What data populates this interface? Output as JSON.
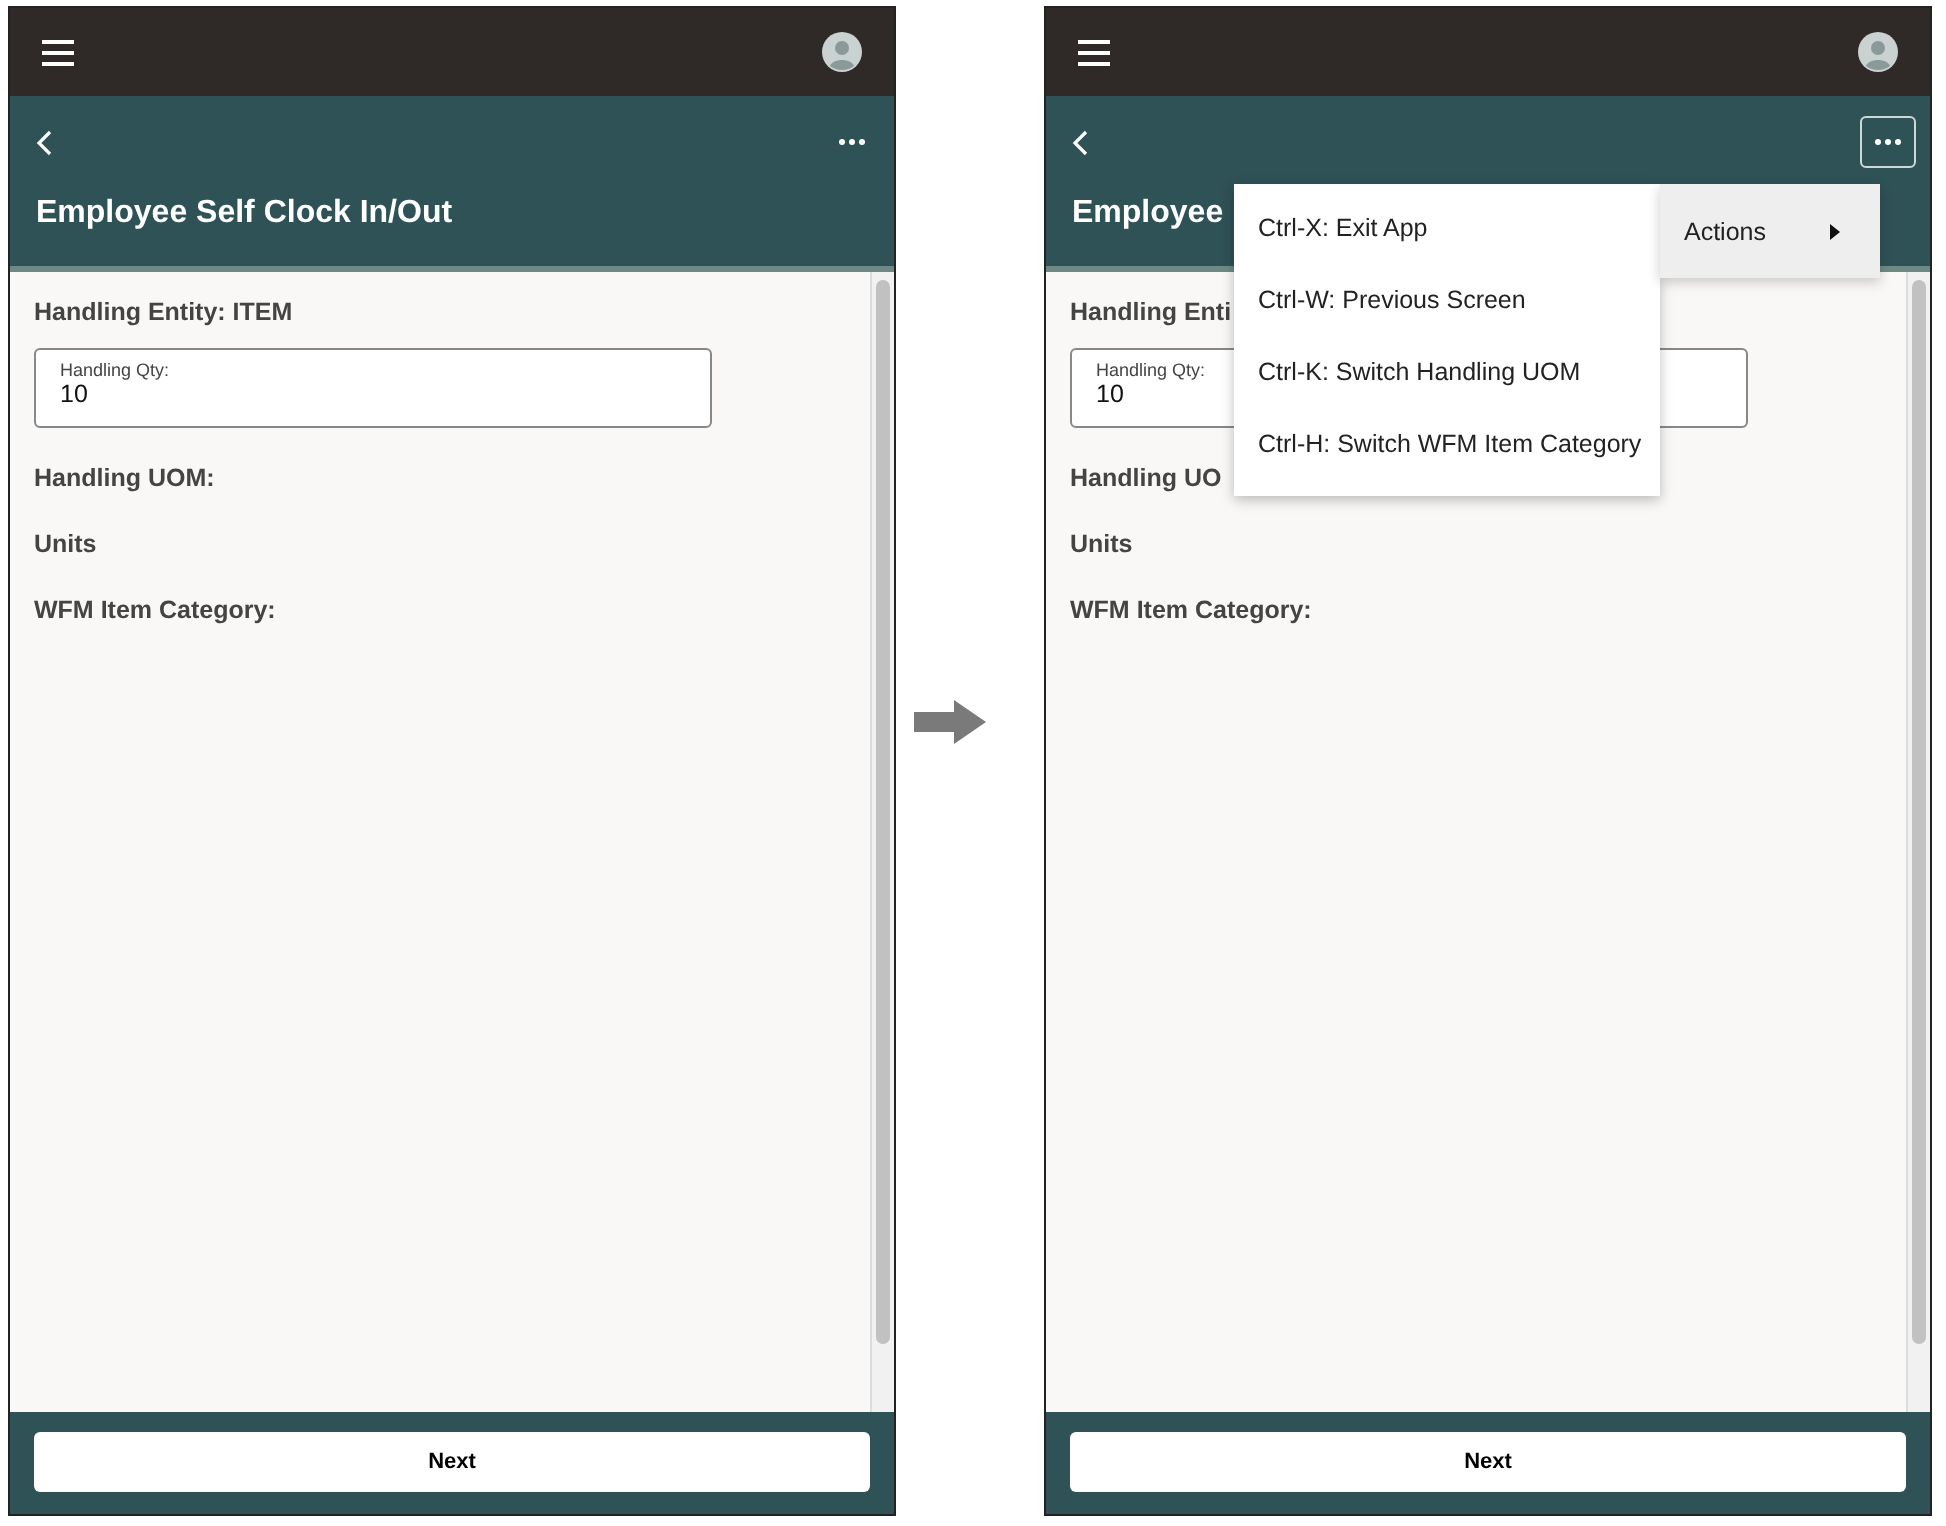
{
  "screens": [
    {
      "header": {
        "title": "Employee Self Clock In/Out",
        "more_active": false
      },
      "content": [
        {
          "kind": "text",
          "text": "Handling Entity: ITEM"
        },
        {
          "kind": "field",
          "label": "Handling Qty:",
          "value": "10"
        },
        {
          "kind": "text",
          "text": "Handling UOM:"
        },
        {
          "kind": "text",
          "text": "Units"
        },
        {
          "kind": "text",
          "text": "WFM Item Category:"
        }
      ],
      "footer": {
        "button": "Next"
      }
    },
    {
      "header": {
        "title": "Employee",
        "more_active": true
      },
      "content": [
        {
          "kind": "text",
          "text": "Handling Enti"
        },
        {
          "kind": "field",
          "label": "Handling Qty:",
          "value": "10"
        },
        {
          "kind": "text",
          "text": "Handling UO"
        },
        {
          "kind": "text",
          "text": "Units"
        },
        {
          "kind": "text",
          "text": "WFM Item Category:"
        }
      ],
      "footer": {
        "button": "Next"
      },
      "menu": {
        "items": [
          "Ctrl-X: Exit App",
          "Ctrl-W: Previous Screen",
          "Ctrl-K: Switch Handling UOM",
          "Ctrl-H: Switch WFM Item Category"
        ],
        "submenu": {
          "label": "Actions"
        }
      }
    }
  ]
}
